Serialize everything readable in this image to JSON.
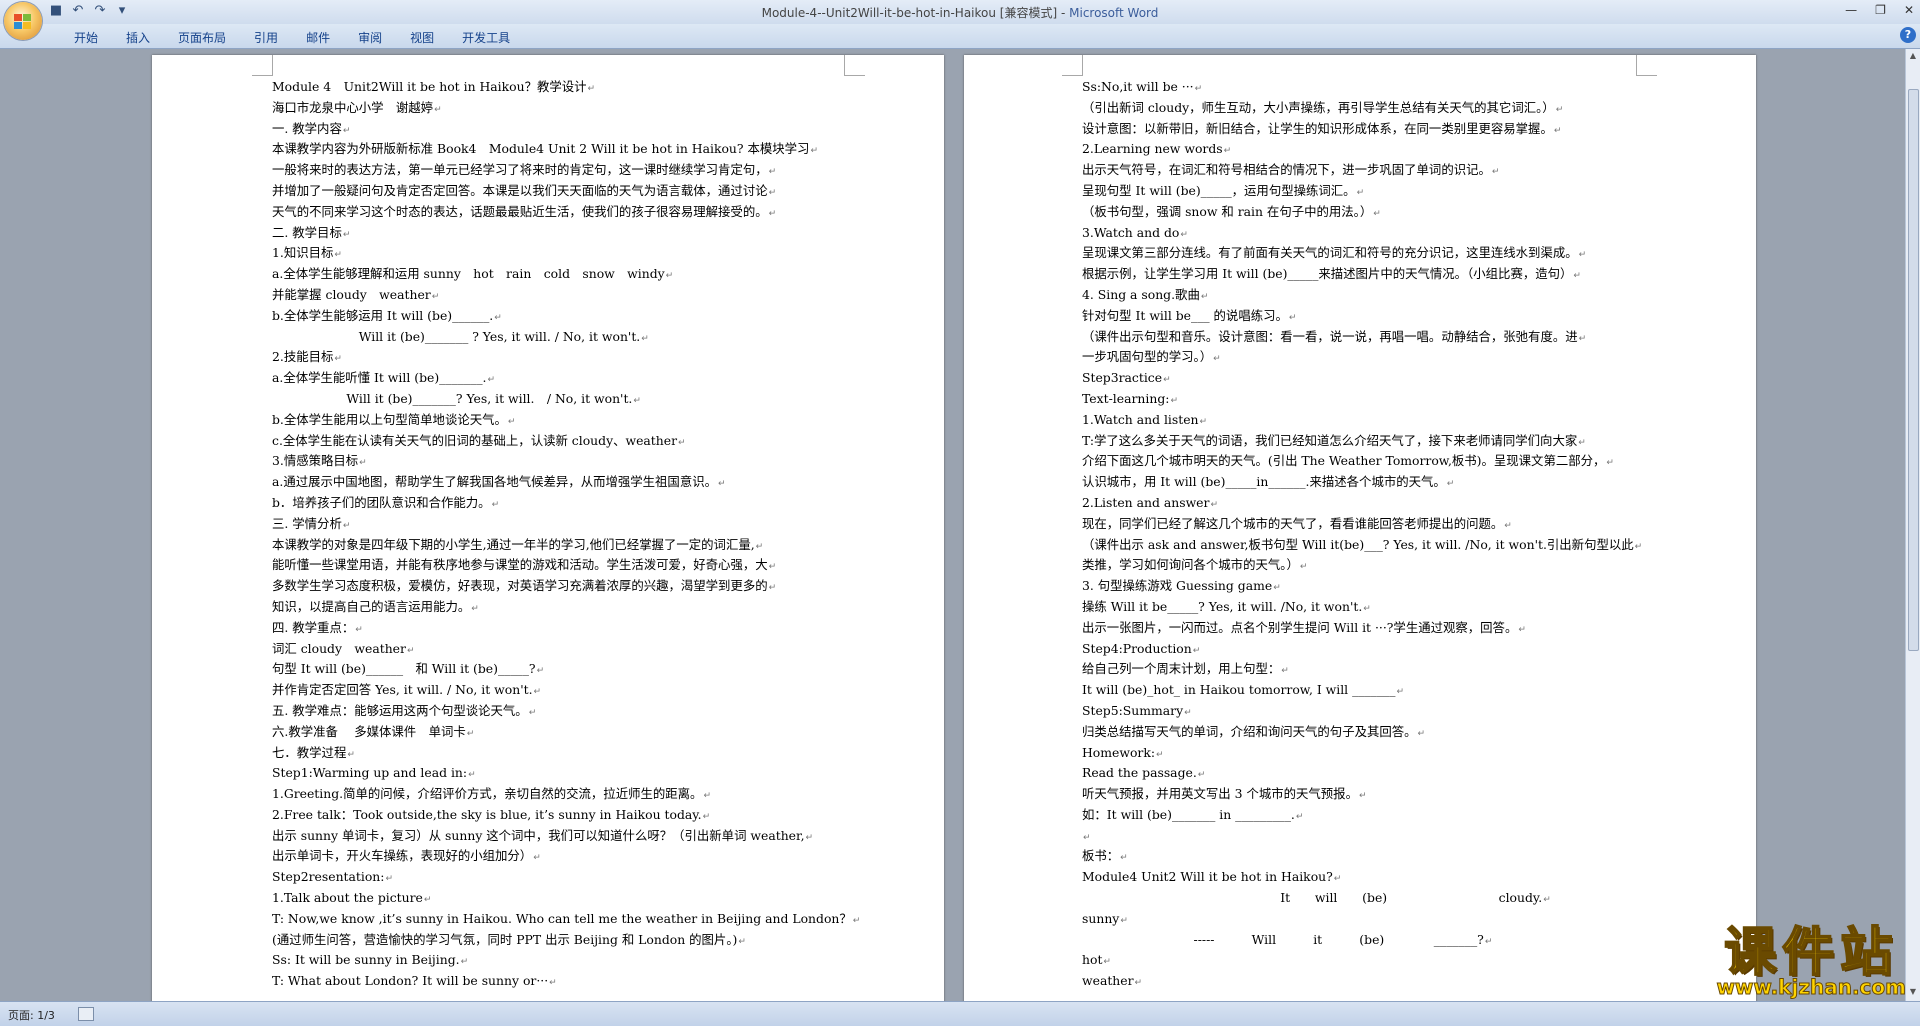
{
  "window": {
    "title": "Module-4--Unit2Will-it-be-hot-in-Haikou [兼容模式] - ",
    "app_name": "Microsoft Word"
  },
  "quick_access": [
    "save-icon",
    "undo-icon",
    "redo-icon",
    "customize-icon"
  ],
  "ribbon": {
    "tabs": [
      "开始",
      "插入",
      "页面布局",
      "引用",
      "邮件",
      "审阅",
      "视图",
      "开发工具"
    ]
  },
  "left_page": {
    "lines": [
      "Module 4　Unit2Will it be hot in Haikou？教学设计",
      "海口市龙泉中心小学　谢越婷",
      "一. 教学内容",
      "本课教学内容为外研版新标准 Book4　Module4 Unit 2 Will it be hot in Haikou? 本模块学习",
      "一般将来时的表达方法，第一单元已经学习了将来时的肯定句，这一课时继续学习肯定句，",
      "并增加了一般疑问句及肯定否定回答。本课是以我们天天面临的天气为语言载体，通过讨论",
      "天气的不同来学习这个时态的表达，话题最最贴近生活，使我们的孩子很容易理解接受的。",
      "二. 教学目标",
      "1.知识目标",
      "a.全体学生能够理解和运用 sunny　hot　rain　cold　snow　windy",
      "并能掌握 cloudy　weather",
      "b.全体学生能够运用  It will (be)______.",
      "　　　　　　　Will it (be)_______ ? Yes, it will. / No, it won't.",
      "2.技能目标",
      "a.全体学生能听懂  It will (be)_______.",
      "　　　　　　Will it (be)_______? Yes, it will.　/ No, it won't.",
      "b.全体学生能用以上句型简单地谈论天气。",
      "c.全体学生能在认读有关天气的旧词的基础上，认读新 cloudy、weather",
      "3.情感策略目标",
      "a.通过展示中国地图，帮助学生了解我国各地气候差异，从而增强学生祖国意识。",
      "b．培养孩子们的团队意识和合作能力。",
      "三. 学情分析",
      "本课教学的对象是四年级下期的小学生,通过一年半的学习,他们已经掌握了一定的词汇量,",
      "能听懂一些课堂用语，并能有秩序地参与课堂的游戏和活动。学生活泼可爱，好奇心强，大",
      "多数学生学习态度积极，爱模仿，好表现，对英语学习充满着浓厚的兴趣，渴望学到更多的",
      "知识，以提高自己的语言运用能力。",
      "四. 教学重点：",
      "词汇 cloudy　weather",
      "句型  It will (be)______　和 Will it (be)_____?",
      "并作肯定否定回答 Yes, it will. / No, it won't.",
      "五. 教学难点：能够运用这两个句型谈论天气。",
      "六.教学准备　 多媒体课件　单词卡",
      "七．教学过程",
      "Step1:Warming up and lead in:",
      "1.Greeting.简单的问候，介绍评价方式，亲切自然的交流，拉近师生的距离。",
      "2.Free talk：Took outside,the sky is blue, it’s sunny in Haikou today.",
      "出示 sunny 单词卡，复习）从 sunny 这个词中，我们可以知道什么呀？（引出新单词  weather,",
      "出示单词卡，开火车操练，表现好的小组加分）",
      "Step2resentation:",
      "1.Talk about the picture",
      "T: Now,we know ,it’s sunny in Haikou. Who can tell me the weather in Beijing and London？",
      "(通过师生问答，营造愉快的学习气氛，同时 PPT 出示 Beijing 和 London 的图片。)",
      "Ss: It will be sunny in Beijing.",
      "T: What about London? It will be sunny or···"
    ]
  },
  "right_page": {
    "lines": [
      "Ss:No,it will be  ···",
      "（引出新词  cloudy，师生互动，大小声操练，再引导学生总结有关天气的其它词汇。）",
      "设计意图：以新带旧，新旧结合，让学生的知识形成体系，在同一类别里更容易掌握。",
      "2.Learning new words",
      "出示天气符号，在词汇和符号相结合的情况下，进一步巩固了单词的识记。",
      "呈现句型 It will (be)_____，运用句型操练词汇。",
      "（板书句型，强调 snow 和 rain 在句子中的用法。）",
      "3.Watch and do",
      "呈现课文第三部分连线。有了前面有关天气的词汇和符号的充分识记，这里连线水到渠成。",
      "根据示例，让学生学习用 It will (be)_____来描述图片中的天气情况。（小组比赛，造句）",
      "4. Sing a song.歌曲",
      "针对句型 It will be___ 的说唱练习。",
      "（课件出示句型和音乐。设计意图：看一看，说一说，再唱一唱。动静结合，张弛有度。进",
      "一步巩固句型的学习。）",
      "Step3ractice",
      "Text-learning:",
      "1.Watch and listen",
      "T:学了这么多关于天气的词语，我们已经知道怎么介绍天气了，接下来老师请同学们向大家",
      "介绍下面这几个城市明天的天气。(引出 The Weather Tomorrow,板书)。呈现课文第二部分，",
      "认识城市，用 It will (be)_____in______.来描述各个城市的天气。",
      "2.Listen and answer",
      "现在，同学们已经了解这几个城市的天气了，看看谁能回答老师提出的问题。",
      "（课件出示 ask and answer,板书句型 Will it(be)___? Yes, it will. /No, it won't.引出新句型以此",
      "类推，学习如何询问各个城市的天气。）",
      "3. 句型操练游戏  Guessing game",
      "操练 Will it be_____? Yes, it will. /No, it won't.",
      "出示一张图片，一闪而过。点名个别学生提问  Will it ···?学生通过观察，回答。",
      "Step4:Production",
      "给自己列一个周末计划，用上句型：",
      "It will (be)_hot_ in Haikou tomorrow, I will _______",
      "Step5:Summary",
      "归类总结描写天气的单词，介绍和询问天气的句子及其回答。",
      "Homework:",
      "Read the passage.",
      "听天气预报，并用英文写出 3 个城市的天气预报。",
      "如：It will (be)_______ in _________.",
      "",
      "板书：",
      "Module4 Unit2 Will it be hot in Haikou?",
      "　　　　　　　　　　　　　　　　It　　will　　(be)　　　　　　　　　cloudy.",
      "sunny",
      "　　　　　　　　　-----　　　Will　　　it　　　(be)　　　　_______?",
      "hot",
      "weather"
    ]
  },
  "status_bar": {
    "page_info": "页面: 1/3"
  },
  "watermark": {
    "name": "课件站",
    "url": "www.kjzhan.com"
  }
}
